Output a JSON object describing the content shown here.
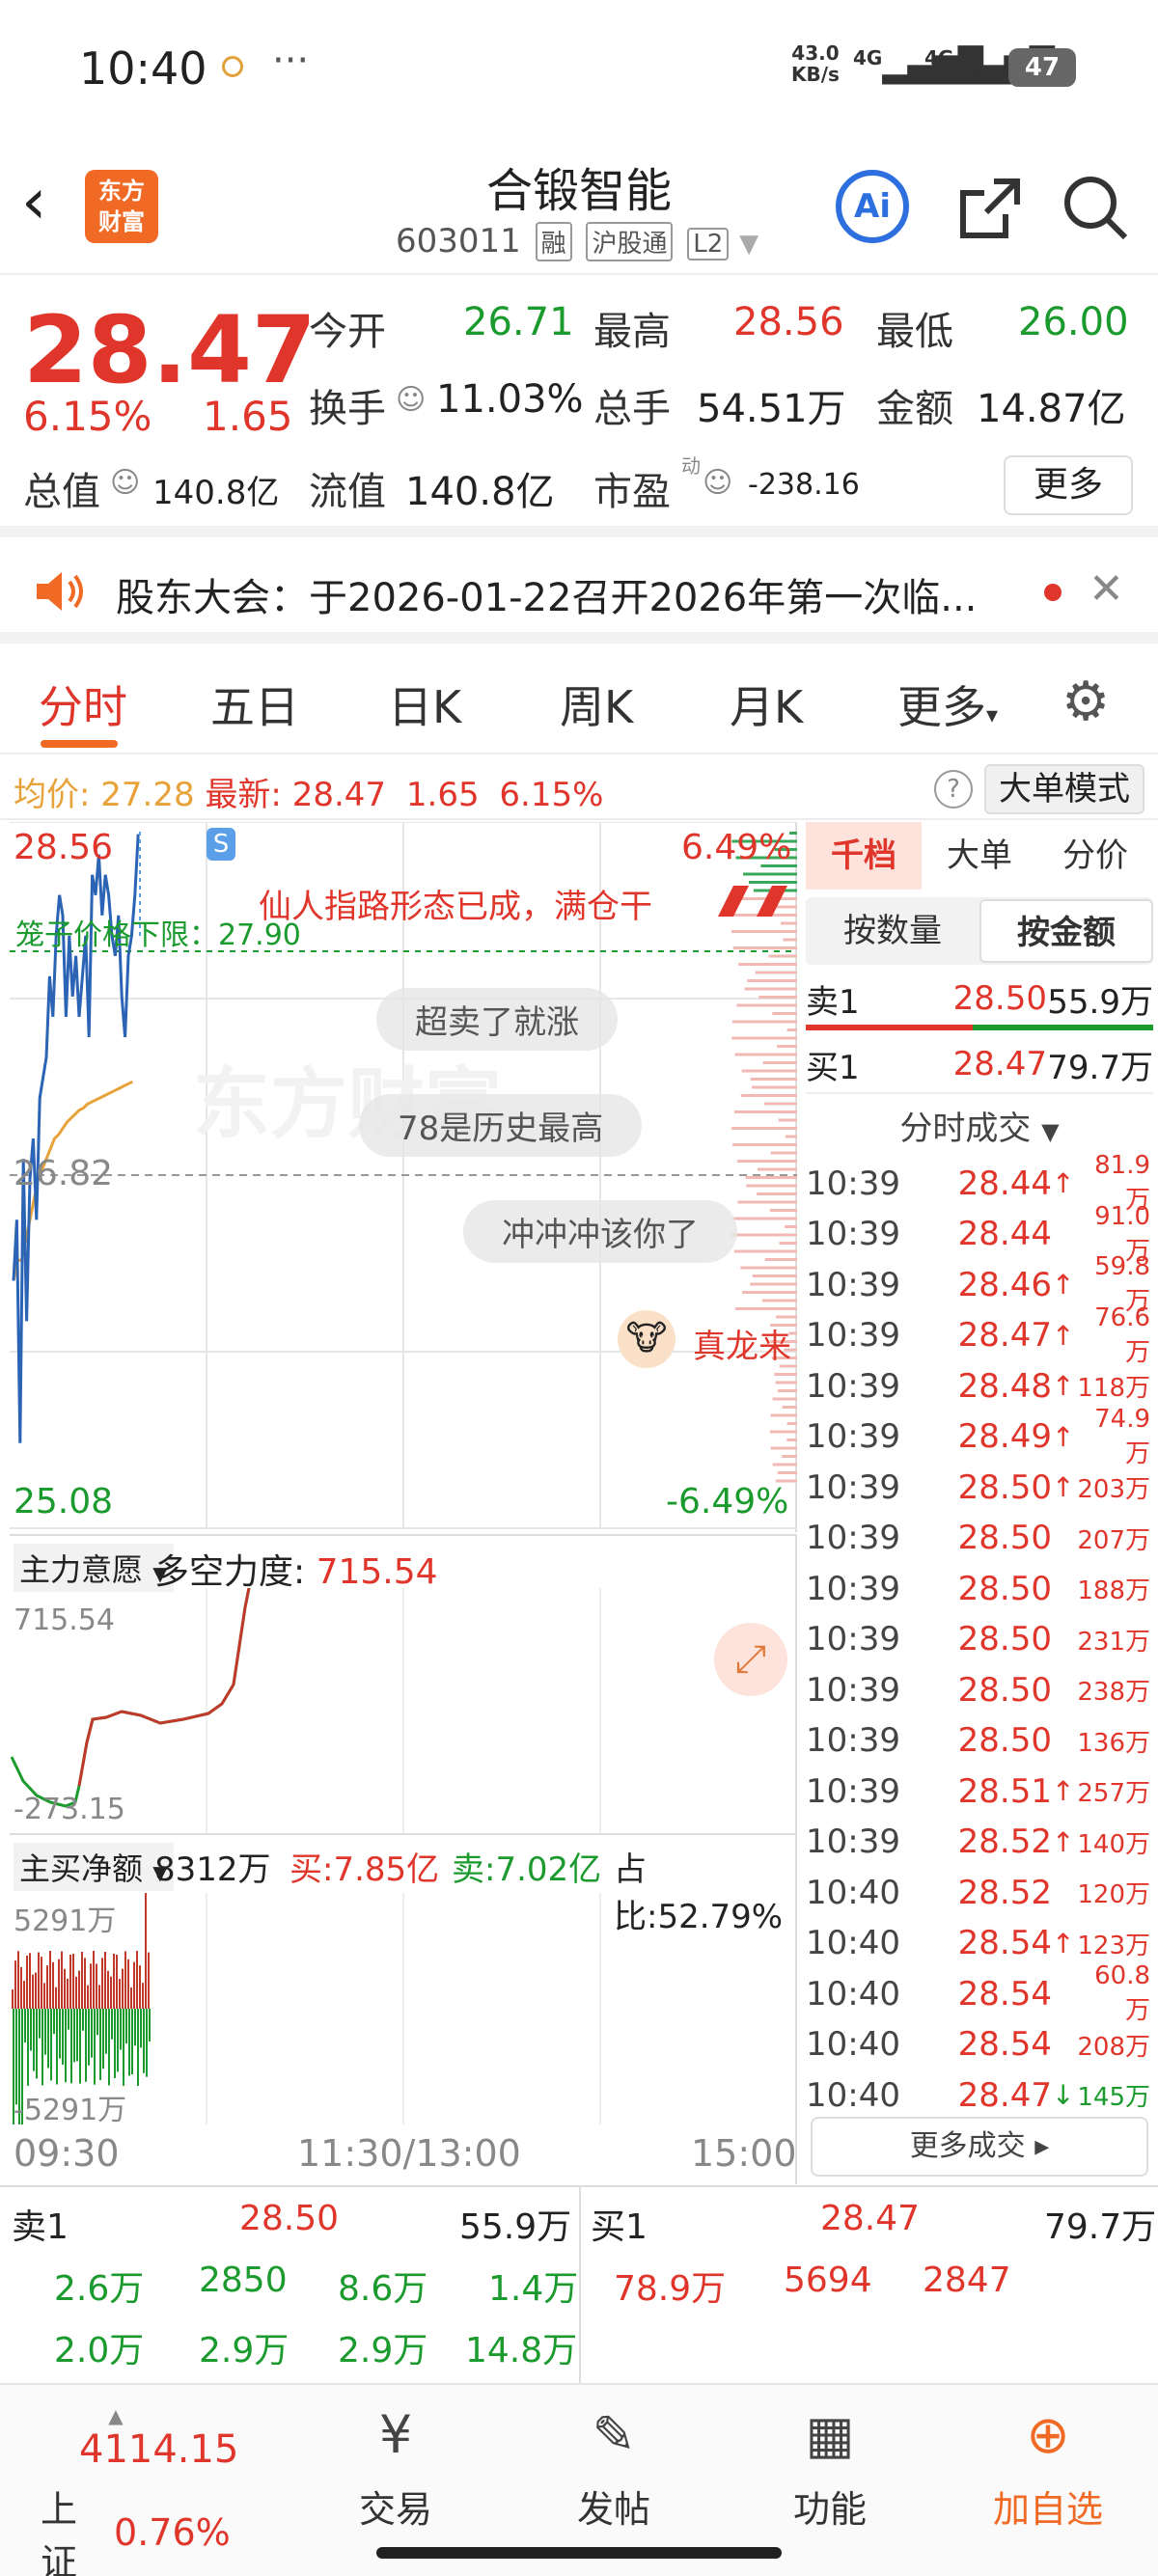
{
  "status": {
    "time": "10:40",
    "dots": "···",
    "speed_top": "43.0",
    "speed_unit": "KB/s",
    "sig1": "4G",
    "sig2": "4G",
    "battery": "47"
  },
  "header": {
    "logo": "东方财富",
    "title": "合锻智能",
    "code": "603011",
    "tags": [
      "融",
      "沪股通",
      "L2"
    ],
    "ai_label": "Ai"
  },
  "quote": {
    "price": "28.47",
    "change_pct": "6.15%",
    "change": "1.65",
    "open_label": "今开",
    "open": "26.71",
    "high_label": "最高",
    "high": "28.56",
    "low_label": "最低",
    "low": "26.00",
    "turnover_label": "换手",
    "turnover": "11.03%",
    "volume_label": "总手",
    "volume": "54.51万",
    "amount_label": "金额",
    "amount": "14.87亿",
    "mktcap_label": "总值",
    "mktcap": "140.8亿",
    "float_label": "流值",
    "float": "140.8亿",
    "pe_label": "市盈",
    "pe_sup": "动",
    "pe": "-238.16",
    "more": "更多"
  },
  "news": {
    "text": "股东大会：于2026-01-22召开2026年第一次临..."
  },
  "tabs": [
    "分时",
    "五日",
    "日K",
    "周K",
    "月K",
    "更多"
  ],
  "info": {
    "avg_label": "均价:",
    "avg": "27.28",
    "latest_label": "最新:",
    "latest": "28.47",
    "chg": "1.65",
    "pct": "6.15%",
    "mode": "大单模式"
  },
  "chart": {
    "y_top": "28.56",
    "y_mid": "26.82",
    "y_bottom": "25.08",
    "pct_top": "6.49%",
    "pct_bottom": "-6.49%",
    "limit_label": "笼子价格下限：27.90",
    "danmaku": [
      "仙人指路形态已成，满仓干",
      "超卖了就涨",
      "78是历史最高",
      "冲冲冲该你了",
      "真龙来"
    ],
    "watermark": "东方财富",
    "s_badge": "S",
    "ind1_select": "主力意愿",
    "ind1_label": "多空力度:",
    "ind1_value": "715.54",
    "ind1_top": "715.54",
    "ind1_bottom": "-273.15",
    "ind2_select": "主买净额",
    "ind2_value": "8312万",
    "ind2_buy": "买:7.85亿",
    "ind2_sell": "卖:7.02亿",
    "ind2_ratio": "占比:52.79%",
    "ind2_top": "5291万",
    "ind2_bottom": "-5291万",
    "x_labels": [
      "09:30",
      "11:30/13:00",
      "15:00"
    ]
  },
  "chart_data": {
    "type": "line",
    "title": "",
    "xlabel": "",
    "ylabel": "",
    "ylim": [
      25.08,
      28.56
    ],
    "series": [
      {
        "name": "",
        "values": [
          26.3,
          26.6,
          25.5,
          26.9,
          26.1,
          26.8,
          27.0,
          26.6,
          27.2,
          27.3,
          27.4,
          27.8,
          27.6,
          28.0,
          28.2,
          28.1,
          27.6,
          28.0,
          27.7,
          27.9,
          27.6,
          27.8,
          28.0,
          27.5,
          28.3,
          28.2,
          28.4,
          28.1,
          28.3,
          28.2,
          28.0,
          27.9,
          28.1,
          27.7,
          27.5,
          27.9,
          28.0,
          28.2,
          28.5
        ]
      },
      {
        "name": "均价",
        "values": [
          26.3,
          26.4,
          26.4,
          26.5,
          26.6,
          26.7,
          26.8,
          26.85,
          26.9,
          26.95,
          27.0,
          27.02,
          27.05,
          27.08,
          27.1,
          27.12,
          27.14,
          27.15,
          27.17,
          27.18,
          27.19,
          27.2,
          27.21,
          27.22,
          27.23,
          27.24,
          27.25,
          27.26,
          27.27,
          27.28
        ]
      }
    ],
    "grid": true
  },
  "book": {
    "seg": [
      "千档",
      "大单",
      "分价"
    ],
    "seg2": [
      "按数量",
      "按金额"
    ],
    "sell1": {
      "label": "卖1",
      "price": "28.50",
      "vol": "55.9万"
    },
    "buy1": {
      "label": "买1",
      "price": "28.47",
      "vol": "79.7万"
    },
    "ticks_title": "分时成交",
    "ticks": [
      {
        "t": "10:39",
        "p": "28.44",
        "a": "↑",
        "v": "81.9万"
      },
      {
        "t": "10:39",
        "p": "28.44",
        "a": "",
        "v": "91.0万"
      },
      {
        "t": "10:39",
        "p": "28.46",
        "a": "↑",
        "v": "59.8万"
      },
      {
        "t": "10:39",
        "p": "28.47",
        "a": "↑",
        "v": "76.6万"
      },
      {
        "t": "10:39",
        "p": "28.48",
        "a": "↑",
        "v": "118万"
      },
      {
        "t": "10:39",
        "p": "28.49",
        "a": "↑",
        "v": "74.9万"
      },
      {
        "t": "10:39",
        "p": "28.50",
        "a": "↑",
        "v": "203万"
      },
      {
        "t": "10:39",
        "p": "28.50",
        "a": "",
        "v": "207万"
      },
      {
        "t": "10:39",
        "p": "28.50",
        "a": "",
        "v": "188万"
      },
      {
        "t": "10:39",
        "p": "28.50",
        "a": "",
        "v": "231万"
      },
      {
        "t": "10:39",
        "p": "28.50",
        "a": "",
        "v": "238万"
      },
      {
        "t": "10:39",
        "p": "28.50",
        "a": "",
        "v": "136万"
      },
      {
        "t": "10:39",
        "p": "28.51",
        "a": "↑",
        "v": "257万"
      },
      {
        "t": "10:39",
        "p": "28.52",
        "a": "↑",
        "v": "140万"
      },
      {
        "t": "10:40",
        "p": "28.52",
        "a": "",
        "v": "120万"
      },
      {
        "t": "10:40",
        "p": "28.54",
        "a": "↑",
        "v": "123万"
      },
      {
        "t": "10:40",
        "p": "28.54",
        "a": "",
        "v": "60.8万"
      },
      {
        "t": "10:40",
        "p": "28.54",
        "a": "",
        "v": "208万"
      },
      {
        "t": "10:40",
        "p": "28.47",
        "a": "↓",
        "v": "145万"
      }
    ],
    "more_ticks": "更多成交 ▸"
  },
  "bottom_book": {
    "sell_label": "卖1",
    "sell_price": "28.50",
    "sell_vol": "55.9万",
    "buy_label": "买1",
    "buy_price": "28.47",
    "buy_vol": "79.7万",
    "sell_row1": [
      "2.6万",
      "2850",
      "8.6万",
      "1.4万"
    ],
    "sell_row2": [
      "2.0万",
      "2.9万",
      "2.9万",
      "14.8万"
    ],
    "buy_row1": [
      "78.9万",
      "5694",
      "2847"
    ]
  },
  "nav": {
    "index_value": "4114.15",
    "index_name": "上证",
    "index_pct": "0.76%",
    "items": [
      "交易",
      "发帖",
      "功能",
      "加自选"
    ]
  },
  "colors": {
    "up": "#e0352b",
    "down": "#1b9a2e",
    "accent": "#f06a25",
    "ai_blue": "#2e6fe0",
    "price_line": "#2b63b5",
    "avg_line": "#e8a23a"
  }
}
